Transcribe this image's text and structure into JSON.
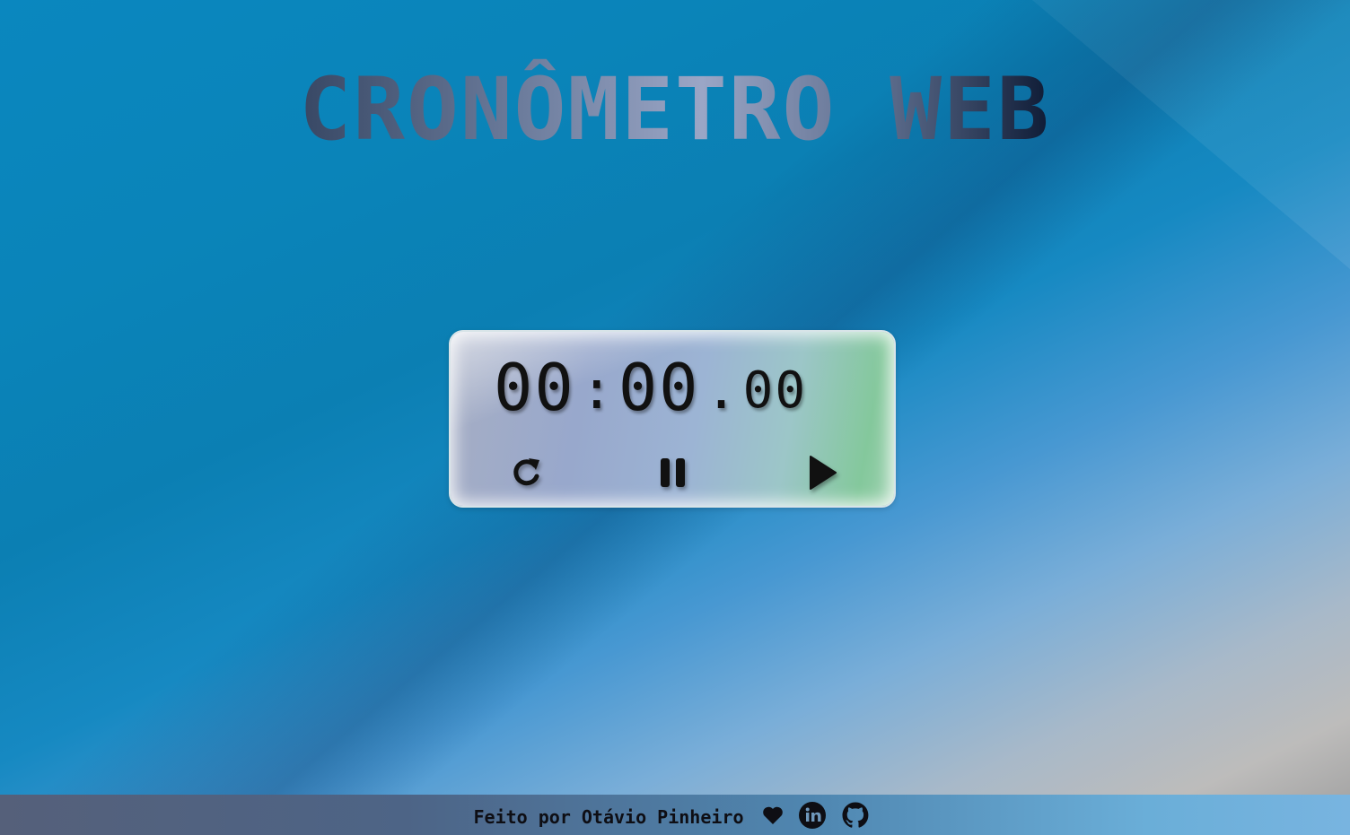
{
  "header": {
    "title": "CRONÔMETRO WEB"
  },
  "stopwatch": {
    "minutes": "00",
    "separator_colon": ":",
    "seconds": "00",
    "separator_dot": ".",
    "centiseconds": "00",
    "controls": {
      "reset": "reset-icon",
      "pause": "pause-icon",
      "play": "play-icon"
    }
  },
  "footer": {
    "credit": "Feito por Otávio Pinheiro",
    "heart": "heart-icon",
    "links": [
      "linkedin-icon",
      "github-icon"
    ]
  }
}
